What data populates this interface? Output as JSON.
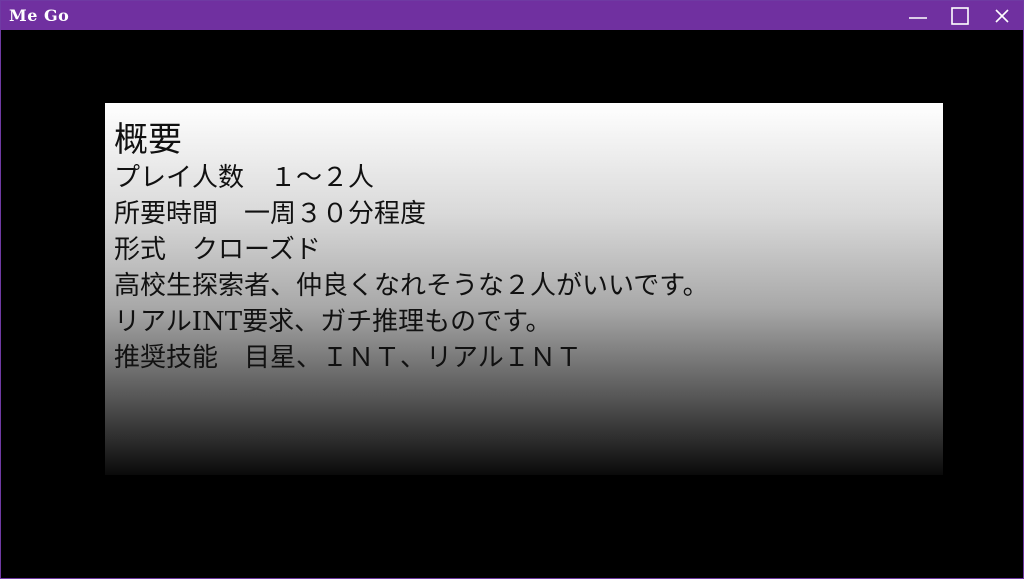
{
  "window": {
    "title": "Me Go",
    "controls": {
      "minimize": "minimize-icon",
      "maximize": "maximize-icon",
      "close": "close-icon"
    },
    "titlebar_color": "#7030a0"
  },
  "panel": {
    "heading": "概要",
    "lines": [
      "プレイ人数　１～２人",
      "所要時間　一周３０分程度",
      "形式　クローズド",
      "高校生探索者、仲良くなれそうな２人がいいです。",
      "リアルINT要求、ガチ推理ものです。",
      "推奨技能　目星、ＩＮＴ、リアルＩＮＴ"
    ]
  }
}
